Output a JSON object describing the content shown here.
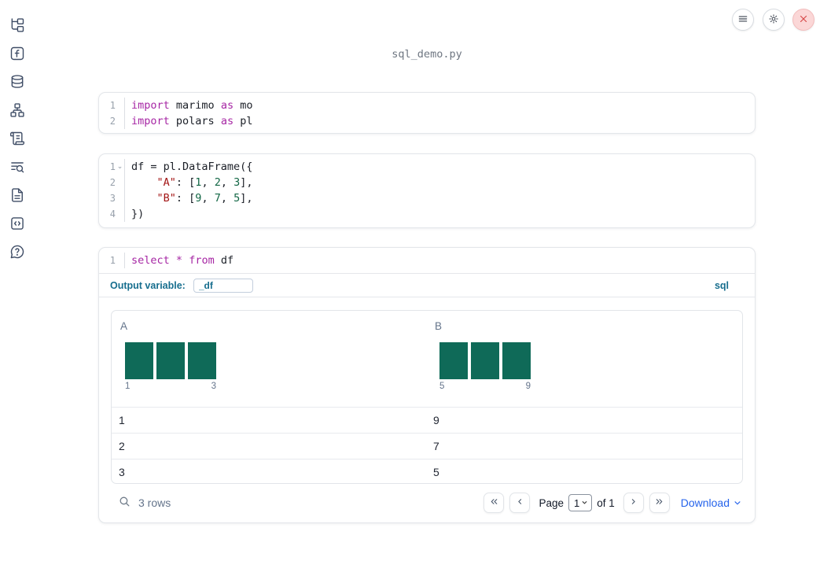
{
  "title": "sql_demo.py",
  "sidebar": {
    "items": [
      {
        "name": "file-explorer"
      },
      {
        "name": "variables"
      },
      {
        "name": "data-sources"
      },
      {
        "name": "dependency-graph"
      },
      {
        "name": "logs"
      },
      {
        "name": "outline-search"
      },
      {
        "name": "documentation"
      },
      {
        "name": "snippets"
      },
      {
        "name": "help"
      }
    ]
  },
  "topbar": {
    "buttons": [
      {
        "name": "menu",
        "icon": "hamburger-icon"
      },
      {
        "name": "settings",
        "icon": "gear-icon"
      },
      {
        "name": "shutdown",
        "icon": "close-icon",
        "color": "#d64949"
      }
    ]
  },
  "cells": {
    "imports": {
      "lines": [
        {
          "num": "1",
          "tokens": [
            {
              "c": "kw",
              "t": "import"
            },
            {
              "c": "pl",
              "t": " marimo "
            },
            {
              "c": "kw",
              "t": "as"
            },
            {
              "c": "pl",
              "t": " mo"
            }
          ]
        },
        {
          "num": "2",
          "tokens": [
            {
              "c": "kw",
              "t": "import"
            },
            {
              "c": "pl",
              "t": " polars "
            },
            {
              "c": "kw",
              "t": "as"
            },
            {
              "c": "pl",
              "t": " pl"
            }
          ]
        }
      ]
    },
    "dataframe": {
      "lines": [
        {
          "num": "1",
          "fold": true,
          "tokens": [
            {
              "c": "pl",
              "t": "df = pl.DataFrame({"
            }
          ]
        },
        {
          "num": "2",
          "tokens": [
            {
              "c": "pl",
              "t": "    "
            },
            {
              "c": "str",
              "t": "\"A\""
            },
            {
              "c": "pl",
              "t": ": ["
            },
            {
              "c": "num",
              "t": "1"
            },
            {
              "c": "pl",
              "t": ", "
            },
            {
              "c": "num",
              "t": "2"
            },
            {
              "c": "pl",
              "t": ", "
            },
            {
              "c": "num",
              "t": "3"
            },
            {
              "c": "pl",
              "t": "],"
            }
          ]
        },
        {
          "num": "3",
          "tokens": [
            {
              "c": "pl",
              "t": "    "
            },
            {
              "c": "str",
              "t": "\"B\""
            },
            {
              "c": "pl",
              "t": ": ["
            },
            {
              "c": "num",
              "t": "9"
            },
            {
              "c": "pl",
              "t": ", "
            },
            {
              "c": "num",
              "t": "7"
            },
            {
              "c": "pl",
              "t": ", "
            },
            {
              "c": "num",
              "t": "5"
            },
            {
              "c": "pl",
              "t": "],"
            }
          ]
        },
        {
          "num": "4",
          "tokens": [
            {
              "c": "pl",
              "t": "})"
            }
          ]
        }
      ]
    },
    "sql": {
      "lines": [
        {
          "num": "1",
          "tokens": [
            {
              "c": "kw",
              "t": "select"
            },
            {
              "c": "pl",
              "t": " "
            },
            {
              "c": "kw",
              "t": "*"
            },
            {
              "c": "pl",
              "t": " "
            },
            {
              "c": "kw",
              "t": "from"
            },
            {
              "c": "pl",
              "t": " df"
            }
          ]
        }
      ],
      "footer": {
        "output_variable_label": "Output variable:",
        "output_variable_value": "_df",
        "language_badge": "sql"
      }
    }
  },
  "table": {
    "columns": [
      {
        "header": "A",
        "hist": {
          "bars": [
            1,
            1,
            1
          ],
          "min_label": "1",
          "max_label": "3"
        }
      },
      {
        "header": "B",
        "hist": {
          "bars": [
            1,
            1,
            1
          ],
          "min_label": "5",
          "max_label": "9"
        }
      }
    ],
    "rows": [
      [
        "1",
        "9"
      ],
      [
        "2",
        "7"
      ],
      [
        "3",
        "5"
      ]
    ],
    "footer": {
      "row_count": "3 rows",
      "page_label": "Page",
      "page_value": "1",
      "of_label": "of 1",
      "download_label": "Download"
    }
  },
  "colors": {
    "histogram_bar": "#0f6a58",
    "keyword": "#a626a4",
    "string": "#a31515",
    "number": "#116644",
    "sql_meta_blue": "#176e8e",
    "download_blue": "#2563eb",
    "close_red": "#d64949"
  }
}
